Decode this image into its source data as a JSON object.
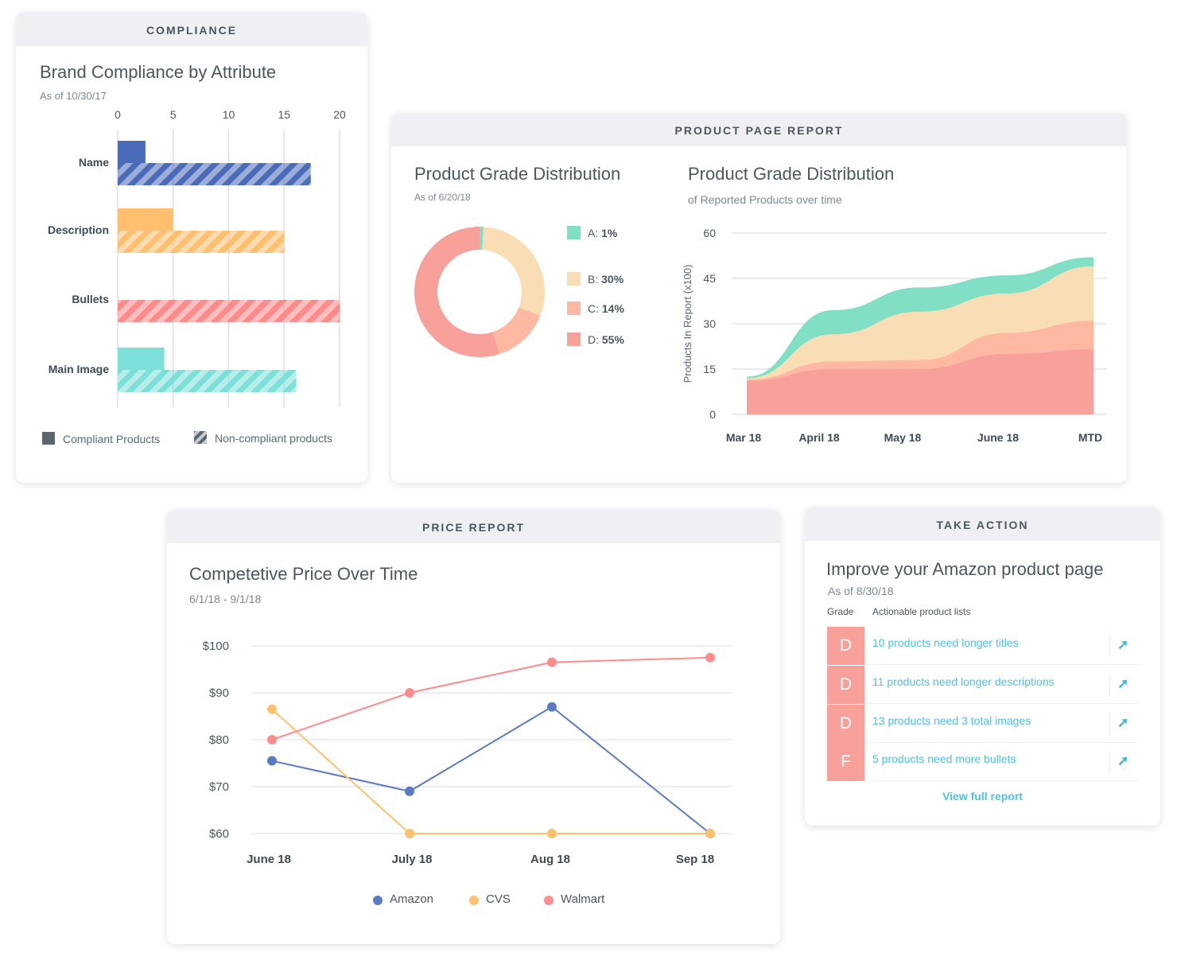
{
  "compliance": {
    "header": "COMPLIANCE",
    "title": "Brand Compliance by Attribute",
    "subtitle": "As of 10/30/17",
    "legend": {
      "compliant": "Compliant Products",
      "noncompliant": "Non-compliant products"
    }
  },
  "product_page": {
    "header": "PRODUCT PAGE REPORT",
    "donut_title": "Product Grade Distribution",
    "donut_subtitle": "As of 6/20/18",
    "area_title": "Product Grade Distribution",
    "area_subtitle": "of Reported Products over time",
    "legend": [
      {
        "letter": "A:",
        "pct": "1%",
        "color": "#80dfc4"
      },
      {
        "letter": "B:",
        "pct": "30%",
        "color": "#f9ddb5"
      },
      {
        "letter": "C:",
        "pct": "14%",
        "color": "#ffb9a3"
      },
      {
        "letter": "D:",
        "pct": "55%",
        "color": "#f8a19a"
      }
    ]
  },
  "price": {
    "header": "PRICE REPORT",
    "title": "Competetive Price Over Time",
    "subtitle": "6/1/18 - 9/1/18"
  },
  "take_action": {
    "header": "TAKE ACTION",
    "title": "Improve your Amazon product page",
    "subtitle": "As of 8/30/18",
    "col_grade": "Grade",
    "col_lists": "Actionable product lists",
    "rows": [
      {
        "grade": "D",
        "text": "10 products need longer titles",
        "icon": "external-arrow-icon"
      },
      {
        "grade": "D",
        "text": "11 products need longer descriptions",
        "icon": "external-arrow-icon"
      },
      {
        "grade": "D",
        "text": "13 products need 3 total images",
        "icon": "external-arrow-icon"
      },
      {
        "grade": "F",
        "text": "5 products need more bullets",
        "icon": "external-arrow-icon"
      }
    ],
    "view_full": "View full report",
    "grade_color": "#f8a19a",
    "link_color": "#4fc0e0"
  },
  "chart_data": [
    {
      "type": "bar",
      "orientation": "horizontal",
      "title": "Brand Compliance by Attribute",
      "subtitle": "As of 10/30/17",
      "categories": [
        "Name",
        "Description",
        "Bullets",
        "Main Image"
      ],
      "category_colors": [
        "#4a6cb8",
        "#ffbf6e",
        "#ff8a8a",
        "#7de0d8"
      ],
      "series": [
        {
          "name": "Compliant Products",
          "values": [
            2.5,
            5,
            0,
            4.2
          ]
        },
        {
          "name": "Non-compliant products",
          "values": [
            17.4,
            15,
            20,
            16.1
          ]
        }
      ],
      "xlim": [
        0,
        20
      ],
      "xticks": [
        "0",
        "5",
        "10",
        "15",
        "20"
      ],
      "grid": true,
      "legend": "bottom"
    },
    {
      "type": "pie",
      "donut": true,
      "title": "Product Grade Distribution",
      "labels": [
        "A",
        "B",
        "C",
        "D"
      ],
      "values": [
        1,
        30,
        14,
        55
      ],
      "colors": [
        "#80dfc4",
        "#f9ddb5",
        "#ffb9a3",
        "#f8a19a"
      ],
      "legend": "right"
    },
    {
      "type": "area",
      "stacked": true,
      "title": "Product Grade Distribution",
      "subtitle": "of Reported Products over time",
      "categories": [
        "Mar 18",
        "April 18",
        "May 18",
        "June 18",
        "MTD"
      ],
      "ylabel": "Products In Report (x100)",
      "ylim": [
        0,
        60
      ],
      "yticks": [
        "0",
        "15",
        "30",
        "45",
        "60"
      ],
      "series": [
        {
          "name": "D",
          "color": "#f8a19a",
          "values": [
            11,
            15,
            15,
            20,
            21.5
          ]
        },
        {
          "name": "C",
          "color": "#ffb9a3",
          "values": [
            0.5,
            2.5,
            3,
            7,
            9.5
          ]
        },
        {
          "name": "B",
          "color": "#f9ddb5",
          "values": [
            0.5,
            9,
            16,
            13,
            18
          ]
        },
        {
          "name": "A",
          "color": "#80dfc4",
          "values": [
            0.5,
            8,
            8,
            6,
            3
          ]
        }
      ],
      "grid": true
    },
    {
      "type": "line",
      "title": "Competetive Price Over Time",
      "subtitle": "6/1/18 - 9/1/18",
      "categories": [
        "June 18",
        "July 18",
        "Aug 18",
        "Sep 18"
      ],
      "ylim": [
        60,
        100
      ],
      "yticks": [
        "$60",
        "$70",
        "$80",
        "$90",
        "$100"
      ],
      "series": [
        {
          "name": "Amazon",
          "color": "#5a7bc4",
          "values": [
            75.5,
            69,
            87,
            60
          ]
        },
        {
          "name": "CVS",
          "color": "#ffc06b",
          "values": [
            86.5,
            60,
            60,
            60
          ]
        },
        {
          "name": "Walmart",
          "color": "#ff8c8c",
          "values": [
            80,
            90,
            96.5,
            97.5
          ]
        }
      ],
      "grid": true,
      "legend": "bottom"
    }
  ]
}
